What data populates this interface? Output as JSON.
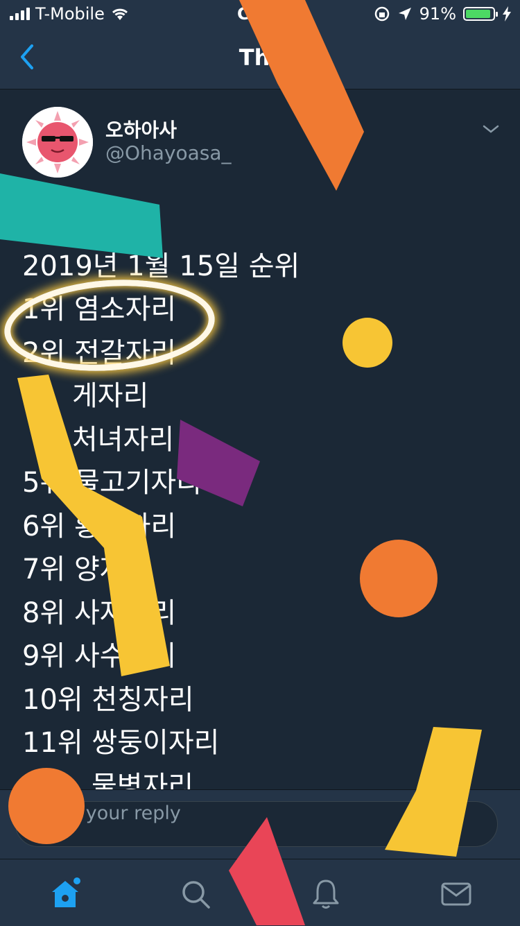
{
  "status_bar": {
    "carrier": "T-Mobile",
    "time": "C",
    "battery": "91%",
    "battery_level": 0.91
  },
  "nav": {
    "back_icon": "chevron-left-icon",
    "title": "Thr"
  },
  "tweet": {
    "display_name": "오하아사",
    "handle": "@Ohayoasa_",
    "lines": [
      "오하아사",
      "2019년 1월 15일 순위",
      "1위 염소자리",
      "2위 전갈자리",
      "게자리",
      "처녀자리",
      "5위 물고기자리",
      "6위 황소자리",
      "7위 양자",
      "8위 사자자리",
      "9위 사수자리",
      "10위 천칭자리",
      "11위 쌍둥이자리",
      "물병자리"
    ]
  },
  "reply": {
    "placeholder": "et your reply"
  },
  "tabs": [
    {
      "name": "home-icon",
      "active": true
    },
    {
      "name": "search-icon",
      "active": false
    },
    {
      "name": "bell-icon",
      "active": false
    },
    {
      "name": "mail-icon",
      "active": false
    }
  ],
  "colors": {
    "background": "#1b2836",
    "bar": "#243447",
    "accent": "#1da1f2",
    "muted": "#8899a6"
  }
}
